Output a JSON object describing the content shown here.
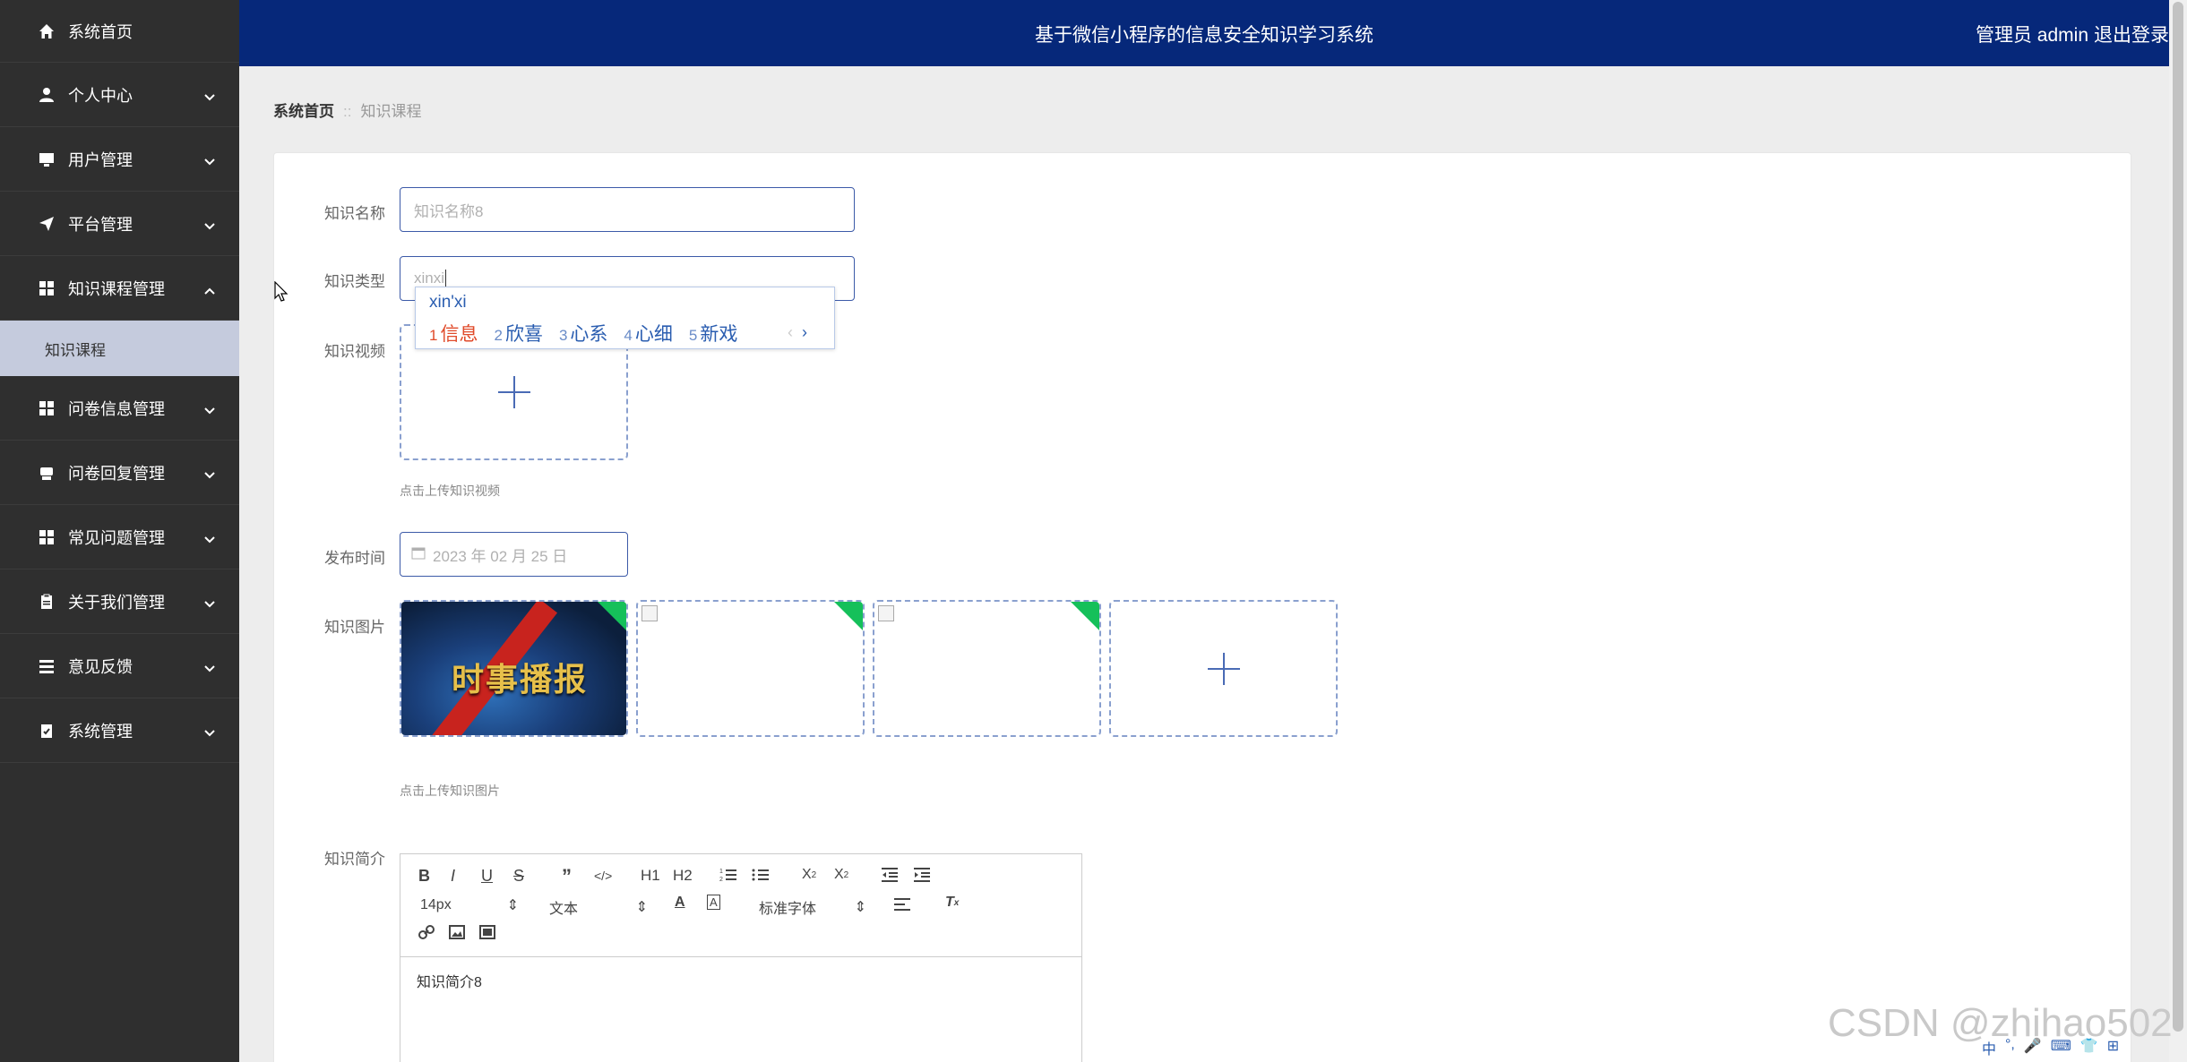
{
  "header": {
    "title": "基于微信小程序的信息安全知识学习系统",
    "user": "管理员 admin",
    "logout": "退出登录"
  },
  "sidebar": {
    "items": [
      {
        "label": "系统首页"
      },
      {
        "label": "个人中心"
      },
      {
        "label": "用户管理"
      },
      {
        "label": "平台管理"
      },
      {
        "label": "知识课程管理"
      },
      {
        "label": "问卷信息管理"
      },
      {
        "label": "问卷回复管理"
      },
      {
        "label": "常见问题管理"
      },
      {
        "label": "关于我们管理"
      },
      {
        "label": "意见反馈"
      },
      {
        "label": "系统管理"
      }
    ],
    "sub_item": "知识课程"
  },
  "breadcrumb": {
    "home": "系统首页",
    "separator": "::",
    "current": "知识课程"
  },
  "form": {
    "name_label": "知识名称",
    "name_placeholder": "知识名称8",
    "type_label": "知识类型",
    "type_value": "xinxi",
    "video_label": "知识视频",
    "video_tip": "点击上传知识视频",
    "time_label": "发布时间",
    "time_value": "2023 年 02 月 25 日",
    "image_label": "知识图片",
    "image_tip": "点击上传知识图片",
    "image_thumb_text": "时事播报",
    "intro_label": "知识简介",
    "intro_content": "知识简介8"
  },
  "ime": {
    "pinyin": "xin'xi",
    "candidates": [
      {
        "n": "1",
        "w": "信息"
      },
      {
        "n": "2",
        "w": "欣喜"
      },
      {
        "n": "3",
        "w": "心系"
      },
      {
        "n": "4",
        "w": "心细"
      },
      {
        "n": "5",
        "w": "新戏"
      }
    ],
    "prev": "‹",
    "next": "›"
  },
  "editor": {
    "font_size": "14px",
    "heading": "文本",
    "font_family": "标准字体",
    "h1": "H1",
    "h2": "H2"
  },
  "watermark": "CSDN @zhihao502",
  "tray": [
    "中",
    "°,",
    "🎤",
    "⌨",
    "👕",
    "⊞"
  ],
  "colors": {
    "header": "#06287a",
    "sidebar": "#2f2f2f",
    "accent": "#3c5aa8",
    "ime_first": "#e04a2a",
    "success_corner": "#15c05a"
  }
}
